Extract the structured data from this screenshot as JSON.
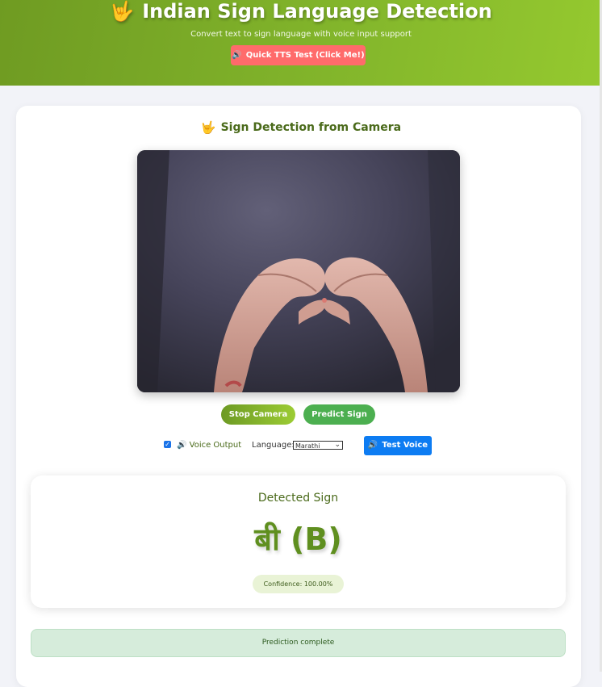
{
  "header": {
    "title": "Indian Sign Language Detection",
    "title_icon": "🤟",
    "subtitle": "Convert text to sign language with voice input support",
    "tts_button_label": "Quick TTS Test (Click Me!)",
    "tts_button_icon": "🔊"
  },
  "camera_section": {
    "title": "Sign Detection from Camera",
    "title_icon": "🤟",
    "stop_button": "Stop Camera",
    "predict_button": "Predict Sign"
  },
  "voice_controls": {
    "voice_output_checked": true,
    "voice_output_icon": "🔊",
    "voice_output_label": "Voice Output",
    "language_label": "Language:",
    "language_selected": "Marathi",
    "test_voice_label": "Test Voice",
    "test_voice_icon": "🔊"
  },
  "result": {
    "label": "Detected Sign",
    "sign": "बी (B)",
    "confidence": "Confidence: 100.00%"
  },
  "status": {
    "message": "Prediction complete"
  },
  "colors": {
    "header_gradient_start": "#6f9b22",
    "header_gradient_end": "#95c92f",
    "tts_button": "#ff6b6b",
    "predict_button": "#4caf50",
    "test_voice_button": "#0d7cf2",
    "sign_text": "#5f8f1f",
    "status_bg": "#d6ecdb"
  }
}
